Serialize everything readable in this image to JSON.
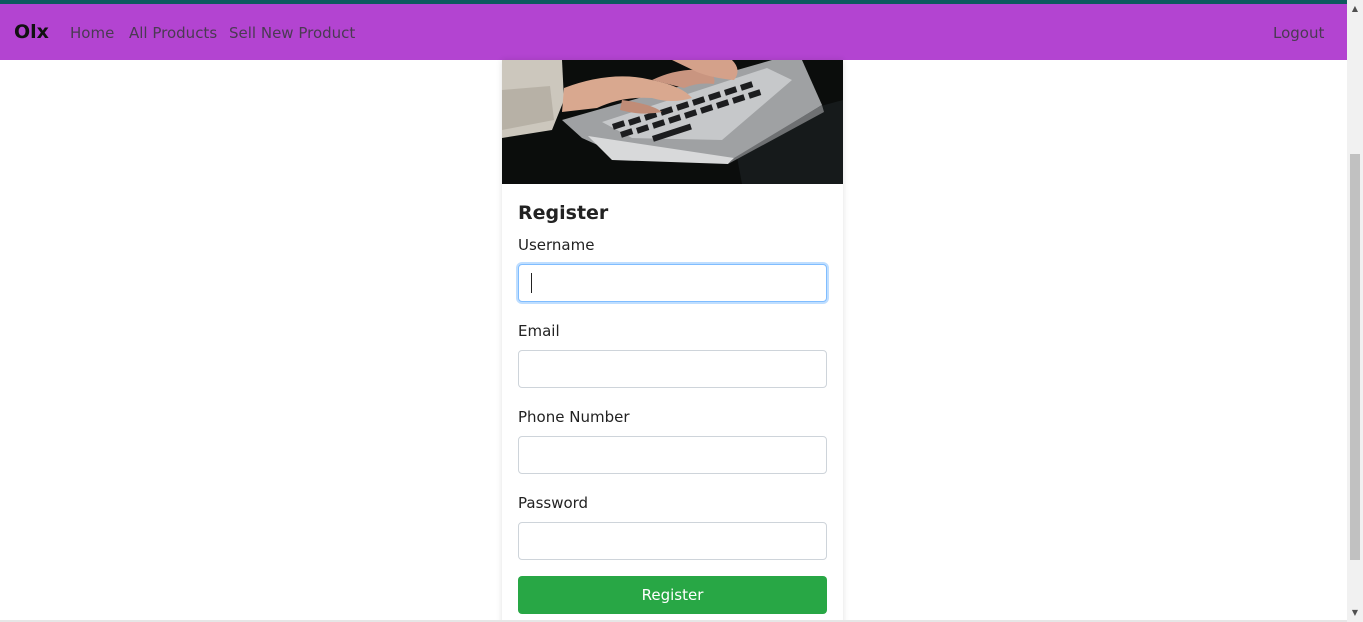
{
  "navbar": {
    "brand": "Olx",
    "links": [
      "Home",
      "All Products",
      "Sell New Product"
    ],
    "logout": "Logout",
    "color": "#b344d1"
  },
  "form": {
    "title": "Register",
    "fields": [
      {
        "label": "Username",
        "value": ""
      },
      {
        "label": "Email",
        "value": ""
      },
      {
        "label": "Phone Number",
        "value": ""
      },
      {
        "label": "Password",
        "value": ""
      }
    ],
    "submit_label": "Register",
    "submit_color": "#28a745"
  },
  "hero_image": {
    "icon": "laptop-typing-photo"
  }
}
